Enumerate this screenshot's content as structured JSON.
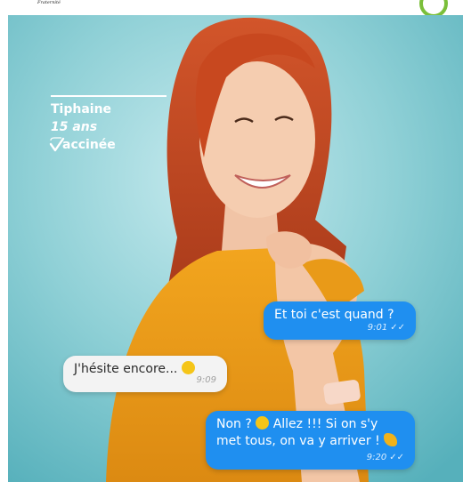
{
  "header": {
    "motto_fragment": "Fraternité",
    "logo_icon": "vaccination-logo-icon"
  },
  "person": {
    "name": "Tiphaine",
    "age": "15 ans",
    "status": "accinée",
    "status_icon": "check-v-icon"
  },
  "messages": [
    {
      "direction": "sent",
      "text": "Et toi c'est quand ?",
      "time": "9:01",
      "read_icon": "double-check-icon"
    },
    {
      "direction": "received",
      "text": "J'hésite encore...",
      "emoji_icon": "worried-face-emoji",
      "time": "9:09"
    },
    {
      "direction": "sent",
      "text_before_emoji": "Non ?",
      "emoji1_icon": "astonished-face-emoji",
      "text_middle": "Allez !!! Si on s'y met tous, on va y arriver !",
      "emoji2_icon": "flexed-biceps-emoji",
      "time": "9:20",
      "read_icon": "double-check-icon"
    }
  ],
  "colors": {
    "sent_bubble": "#1f8ff0",
    "received_bubble": "#f3f3f3",
    "background_teal": "#5fb7c1",
    "logo_green": "#7bbf3a"
  }
}
